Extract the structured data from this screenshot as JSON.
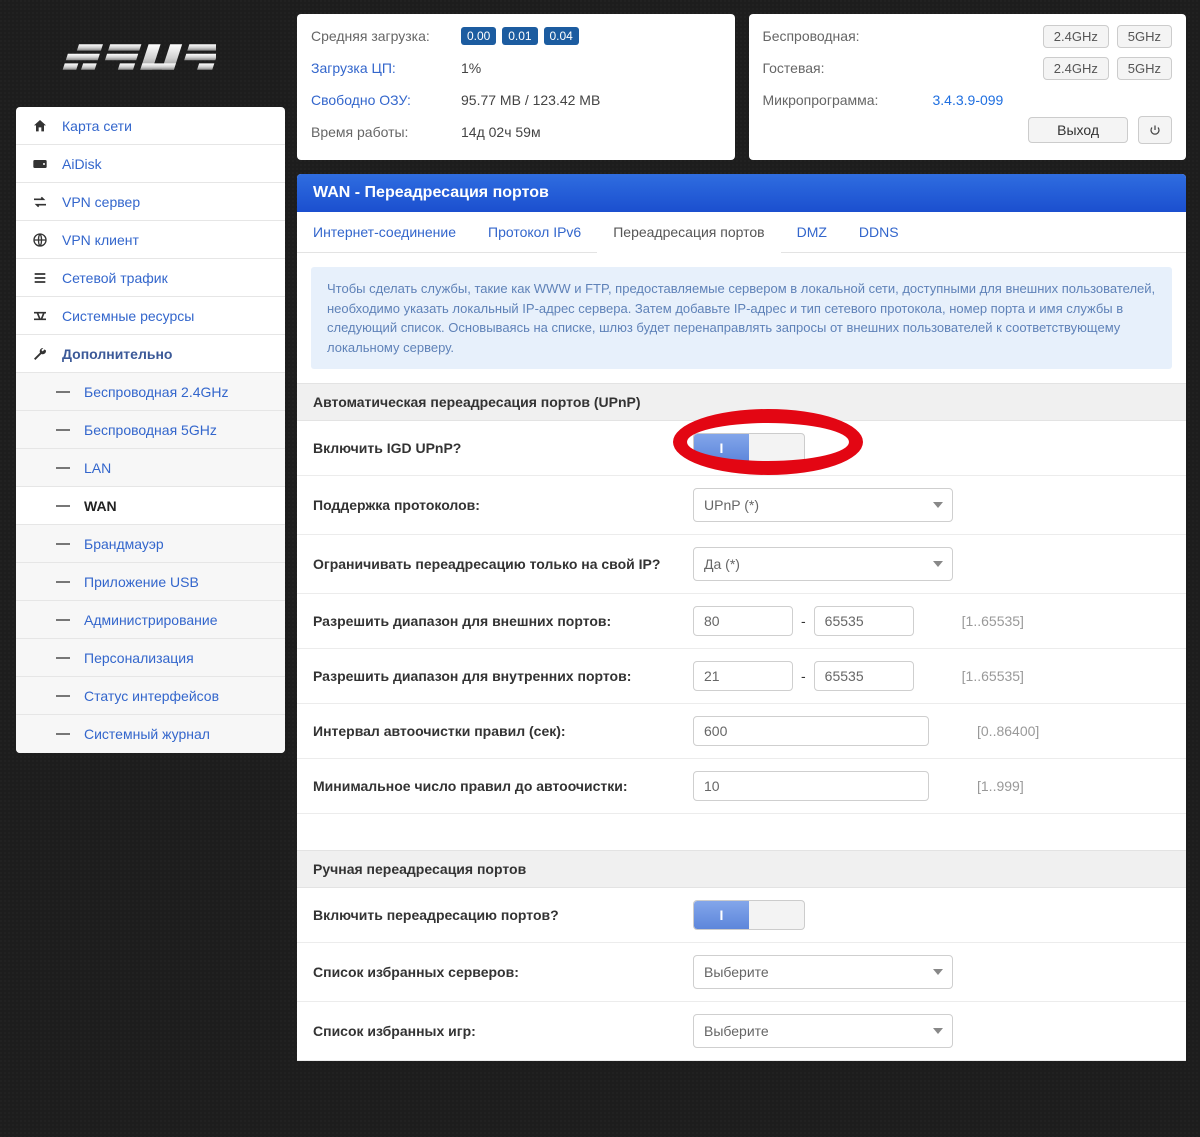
{
  "status": {
    "load_avg_label": "Средняя загрузка:",
    "load_avg_values": [
      "0.00",
      "0.01",
      "0.04"
    ],
    "cpu_label": "Загрузка ЦП:",
    "cpu_value": "1%",
    "ram_label": "Свободно ОЗУ:",
    "ram_value": "95.77 MB / 123.42 MB",
    "uptime_label": "Время работы:",
    "uptime_value": "14д 02ч 59м",
    "wireless_label": "Беспроводная:",
    "guest_label": "Гостевая:",
    "fw_label": "Микропрограмма:",
    "fw_value": "3.4.3.9-099",
    "btn_24": "2.4GHz",
    "btn_5": "5GHz",
    "logout": "Выход"
  },
  "nav": {
    "map": "Карта сети",
    "aidisk": "AiDisk",
    "vpn_server": "VPN сервер",
    "vpn_client": "VPN клиент",
    "traffic": "Сетевой трафик",
    "sysres": "Системные ресурсы",
    "advanced": "Дополнительно",
    "sub": {
      "wifi24": "Беспроводная 2.4GHz",
      "wifi5": "Беспроводная 5GHz",
      "lan": "LAN",
      "wan": "WAN",
      "firewall": "Брандмауэр",
      "usb": "Приложение USB",
      "admin": "Администрирование",
      "personal": "Персонализация",
      "ifstatus": "Статус интерфейсов",
      "syslog": "Системный журнал"
    }
  },
  "main": {
    "title": "WAN - Переадресация портов",
    "tabs": {
      "internet": "Интернет-соединение",
      "ipv6": "Протокол IPv6",
      "portfwd": "Переадресация портов",
      "dmz": "DMZ",
      "ddns": "DDNS"
    },
    "infobox": "Чтобы сделать службы, такие как WWW и FTP, предоставляемые сервером в локальной сети, доступными для внешних пользователей, необходимо указать локальный IP-адрес сервера. Затем добавьте IP-адрес и тип сетевого протокола, номер порта и имя службы в следующий список. Основываясь на списке, шлюз будет перенаправлять запросы от внешних пользователей к соответствующему локальному серверу.",
    "section_upnp": "Автоматическая переадресация портов (UPnP)",
    "upnp_enable_label": "Включить IGD UPnP?",
    "proto_label": "Поддержка протоколов:",
    "proto_value": "UPnP (*)",
    "restrict_label": "Ограничивать переадресацию только на свой IP?",
    "restrict_value": "Да (*)",
    "ext_range_label": "Разрешить диапазон для внешних портов:",
    "ext_from": "80",
    "ext_to": "65535",
    "ext_hint": "[1..65535]",
    "int_range_label": "Разрешить диапазон для внутренних портов:",
    "int_from": "21",
    "int_to": "65535",
    "int_hint": "[1..65535]",
    "clean_interval_label": "Интервал автоочистки правил (сек):",
    "clean_interval_value": "600",
    "clean_interval_hint": "[0..86400]",
    "clean_min_label": "Минимальное число правил до автоочистки:",
    "clean_min_value": "10",
    "clean_min_hint": "[1..999]",
    "section_manual": "Ручная переадресация портов",
    "manual_enable_label": "Включить переадресацию портов?",
    "fav_servers_label": "Список избранных серверов:",
    "fav_servers_value": "Выберите",
    "fav_games_label": "Список избранных игр:",
    "fav_games_value": "Выберите",
    "toggle_on": "I",
    "dash": "-"
  }
}
